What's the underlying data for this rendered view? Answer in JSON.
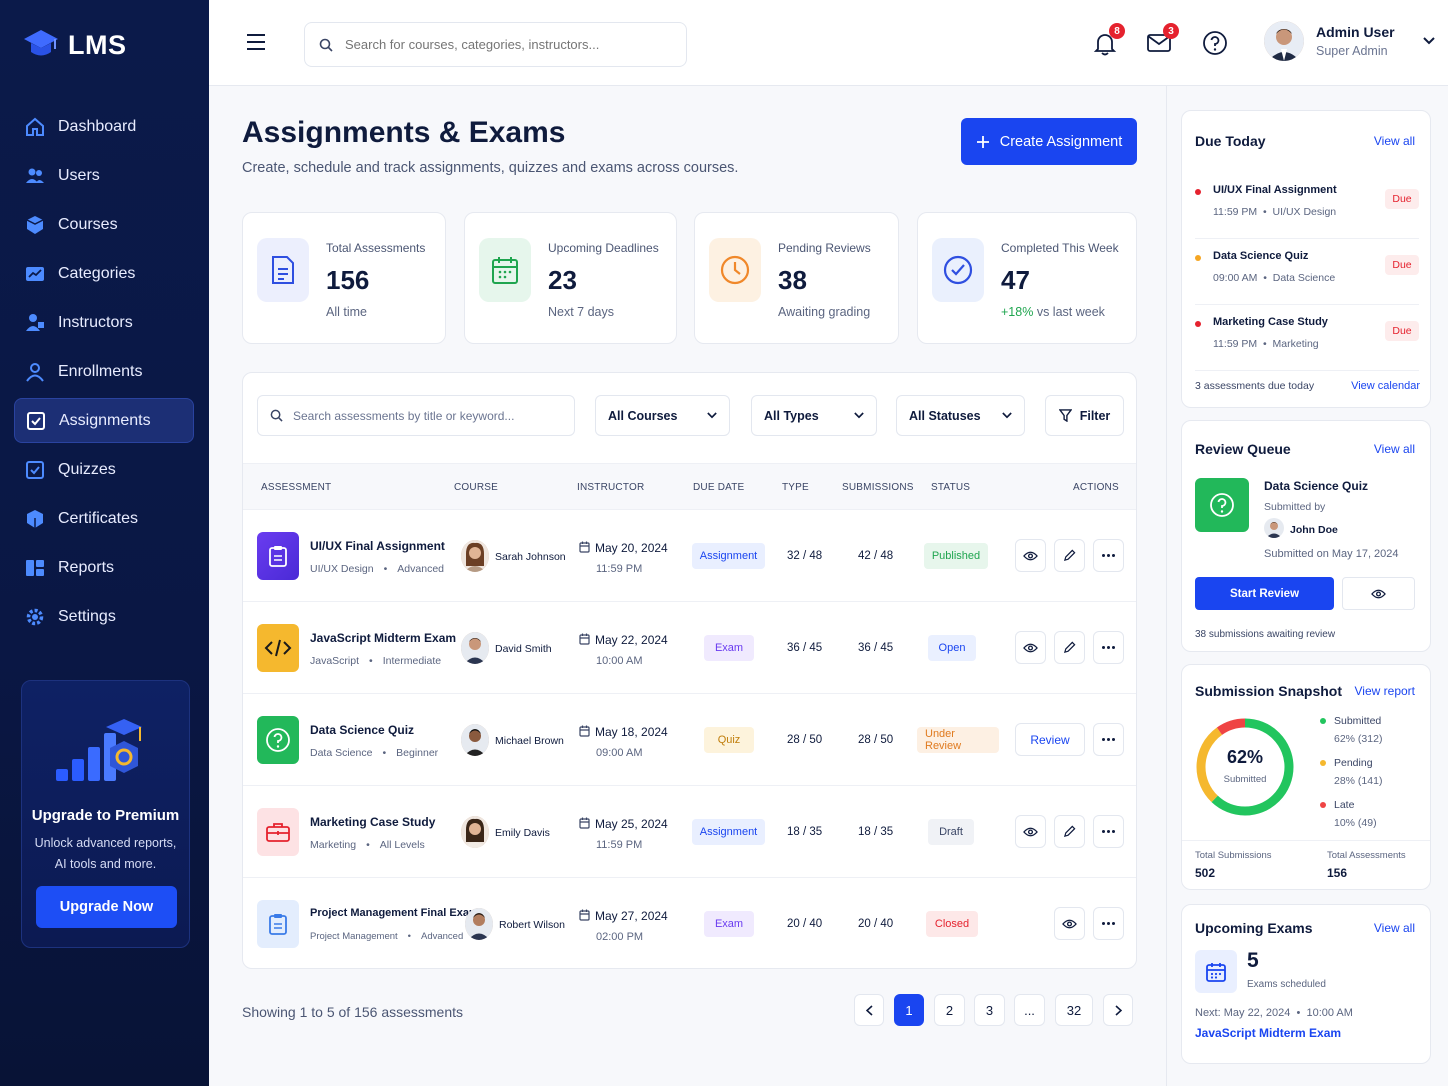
{
  "app": {
    "name": "LMS"
  },
  "sidebar": {
    "items": [
      {
        "label": "Dashboard",
        "icon": "home-icon"
      },
      {
        "label": "Users",
        "icon": "users-icon"
      },
      {
        "label": "Courses",
        "icon": "box-icon"
      },
      {
        "label": "Categories",
        "icon": "chart-icon"
      },
      {
        "label": "Instructors",
        "icon": "instructor-icon"
      },
      {
        "label": "Enrollments",
        "icon": "person-icon"
      },
      {
        "label": "Assignments",
        "icon": "checkbox-icon",
        "active": true
      },
      {
        "label": "Quizzes",
        "icon": "checkbox-icon"
      },
      {
        "label": "Certificates",
        "icon": "certificate-icon"
      },
      {
        "label": "Reports",
        "icon": "reports-icon"
      },
      {
        "label": "Settings",
        "icon": "gear-icon"
      }
    ],
    "promo": {
      "title": "Upgrade to Premium",
      "subtitle": "Unlock advanced reports, AI tools and more.",
      "button": "Upgrade Now"
    }
  },
  "topbar": {
    "search_placeholder": "Search for courses, categories, instructors...",
    "notifications_count": "8",
    "messages_count": "3",
    "user": {
      "name": "Admin User",
      "role": "Super Admin"
    }
  },
  "page": {
    "title": "Assignments & Exams",
    "subtitle": "Create, schedule and track assignments, quizzes and exams across courses.",
    "create_button": "Create Assignment"
  },
  "stats": [
    {
      "label": "Total Assessments",
      "value": "156",
      "note": "All time"
    },
    {
      "label": "Upcoming Deadlines",
      "value": "23",
      "note": "Next 7 days"
    },
    {
      "label": "Pending Reviews",
      "value": "38",
      "note": "Awaiting grading"
    },
    {
      "label": "Completed This Week",
      "value": "47",
      "note_highlight": "+18%",
      "note": "vs last week"
    }
  ],
  "filters": {
    "search_placeholder": "Search assessments by title or keyword...",
    "courses": "All Courses",
    "types": "All Types",
    "statuses": "All Statuses",
    "filter_button": "Filter"
  },
  "table": {
    "headers": [
      "ASSESSMENT",
      "COURSE",
      "INSTRUCTOR",
      "DUE DATE",
      "TYPE",
      "SUBMISSIONS",
      "STATUS",
      "ACTIONS"
    ],
    "rows": [
      {
        "title": "UI/UX Final Assignment",
        "course": "UI/UX Design",
        "level": "Advanced",
        "instructor": "Sarah Johnson",
        "date": "May 20, 2024",
        "time": "11:59 PM",
        "type": "Assignment",
        "type_col": "32 / 48",
        "submissions": "42 / 48",
        "status": "Published"
      },
      {
        "title": "JavaScript Midterm Exam",
        "course": "JavaScript",
        "level": "Intermediate",
        "instructor": "David Smith",
        "date": "May 22, 2024",
        "time": "10:00 AM",
        "type": "Exam",
        "type_col": "36 / 45",
        "submissions": "36 / 45",
        "status": "Open"
      },
      {
        "title": "Data Science Quiz",
        "course": "Data Science",
        "level": "Beginner",
        "instructor": "Michael Brown",
        "date": "May 18, 2024",
        "time": "09:00 AM",
        "type": "Quiz",
        "type_col": "28 / 50",
        "submissions": "28 / 50",
        "status": "Under Review",
        "action": "Review"
      },
      {
        "title": "Marketing Case Study",
        "course": "Marketing",
        "level": "All Levels",
        "instructor": "Emily Davis",
        "date": "May 25, 2024",
        "time": "11:59 PM",
        "type": "Assignment",
        "type_col": "18 / 35",
        "submissions": "18 / 35",
        "status": "Draft"
      },
      {
        "title": "Project Management Final Exam",
        "course": "Project Management",
        "level": "Advanced",
        "instructor": "Robert Wilson",
        "date": "May 27, 2024",
        "time": "02:00 PM",
        "type": "Exam",
        "type_col": "20 / 40",
        "submissions": "20 / 40",
        "status": "Closed"
      }
    ]
  },
  "pagination": {
    "showing": "Showing 1 to 5 of 156 assessments",
    "pages": [
      "1",
      "2",
      "3",
      "...",
      "32"
    ]
  },
  "due_today": {
    "title": "Due Today",
    "view_all": "View all",
    "items": [
      {
        "title": "UI/UX Final Assignment",
        "time": "11:59 PM",
        "course": "UI/UX Design",
        "tag": "Due",
        "color": "#e5222e"
      },
      {
        "title": "Data Science Quiz",
        "time": "09:00 AM",
        "course": "Data Science",
        "tag": "Due",
        "color": "#f5a623"
      },
      {
        "title": "Marketing Case Study",
        "time": "11:59 PM",
        "course": "Marketing",
        "tag": "Due",
        "color": "#e5222e"
      }
    ],
    "footer": "3 assessments due today",
    "calendar_link": "View calendar"
  },
  "review_queue": {
    "title": "Review Queue",
    "view_all": "View all",
    "item_title": "Data Science Quiz",
    "submitted_by_label": "Submitted by",
    "student": "John Doe",
    "submitted_on": "Submitted on May 17, 2024",
    "start_button": "Start Review",
    "footer": "38 submissions awaiting review"
  },
  "snapshot": {
    "title": "Submission Snapshot",
    "view_report": "View report",
    "center_value": "62%",
    "center_label": "Submitted",
    "legend": [
      {
        "label": "Submitted",
        "value": "62% (312)",
        "color": "#22c55e"
      },
      {
        "label": "Pending",
        "value": "28% (141)",
        "color": "#f5b82e"
      },
      {
        "label": "Late",
        "value": "10% (49)",
        "color": "#ef4444"
      }
    ],
    "total_submissions_label": "Total Submissions",
    "total_submissions": "502",
    "total_assessments_label": "Total Assessments",
    "total_assessments": "156"
  },
  "upcoming_exams": {
    "title": "Upcoming Exams",
    "view_all": "View all",
    "count": "5",
    "count_label": "Exams scheduled",
    "next": "Next: May 22, 2024  •  10:00 AM",
    "next_exam": "JavaScript Midterm Exam"
  }
}
